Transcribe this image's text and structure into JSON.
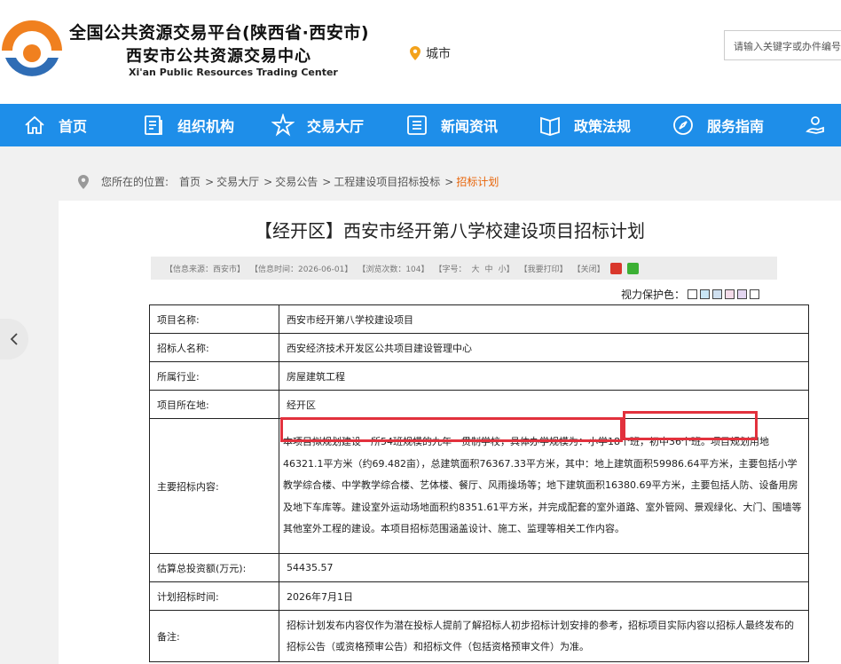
{
  "header": {
    "org_name_cn": "全国公共资源交易平台(陕西省·西安市)",
    "org_sub_cn": "西安市公共资源交易中心",
    "org_name_en": "Xi'an Public Resources Trading Center",
    "city_label": "城市",
    "search_placeholder": "请输入关键字或办件编号",
    "colors": {
      "brand_blue": "#1e8ee9",
      "logo_orange": "#f0801f",
      "logo_blue": "#2f6db5"
    }
  },
  "nav": {
    "items": [
      {
        "label": "首页",
        "icon": "home-icon"
      },
      {
        "label": "组织机构",
        "icon": "document-icon"
      },
      {
        "label": "交易大厅",
        "icon": "star-icon"
      },
      {
        "label": "新闻资讯",
        "icon": "list-icon"
      },
      {
        "label": "政策法规",
        "icon": "book-icon"
      },
      {
        "label": "服务指南",
        "icon": "compass-icon"
      }
    ]
  },
  "breadcrumb": {
    "prefix": "您所在的位置:",
    "items": [
      "首页",
      "交易大厅",
      "交易公告",
      "工程建设项目招标投标"
    ],
    "separator": ">",
    "current": "招标计划"
  },
  "article": {
    "title": "【经开区】西安市经开第八学校建设项目招标计划",
    "meta": {
      "source": "【信息来源：西安市】",
      "time": "【信息时间：2026-06-01】",
      "views": "【浏览次数：104】",
      "fontsize_prefix": "【字号：",
      "font_large": "大",
      "font_medium": "中",
      "font_small": "小】",
      "print": "【我要打印】",
      "close": "【关闭】"
    },
    "vision_label": "视力保护色：",
    "vision_colors": [
      "#ffffff",
      "#c9e6f5",
      "#cfe0f0",
      "#f3dbe9",
      "#e3d5f0",
      "#ffffff"
    ]
  },
  "table": {
    "rows": [
      {
        "key": "项目名称:",
        "value": "西安市经开第八学校建设项目"
      },
      {
        "key": "招标人名称:",
        "value": "西安经济技术开发区公共项目建设管理中心"
      },
      {
        "key": "所属行业:",
        "value": "房屋建筑工程"
      },
      {
        "key": "项目所在地:",
        "value": "经开区"
      },
      {
        "key": "主要招标内容:",
        "value": "本项目拟规划建设一所54班规模的九年一贯制学校，具体办学规模为：小学18个班，初中36个班。项目规划用地46321.1平方米（约69.482亩），总建筑面积76367.33平方米，其中：地上建筑面积59986.64平方米，主要包括小学教学综合楼、中学教学综合楼、艺体楼、餐厅、风雨操场等；地下建筑面积16380.69平方米，主要包括人防、设备用房及地下车库等。建设室外运动场地面积约8351.61平方米，并完成配套的室外道路、室外管网、景观绿化、大门、围墙等其他室外工程的建设。本项目招标范围涵盖设计、施工、监理等相关工作内容。"
      },
      {
        "key": "估算总投资额(万元):",
        "value": "54435.57"
      },
      {
        "key": "计划招标时间:",
        "value": "2026年7月1日"
      },
      {
        "key": "备注:",
        "value": "招标计划发布内容仅作为潜在投标人提前了解招标人初步招标计划安排的参考，招标项目实际内容以招标人最终发布的招标公告（或资格预审公告）和招标文件（包括资格预审文件）为准。"
      }
    ]
  }
}
